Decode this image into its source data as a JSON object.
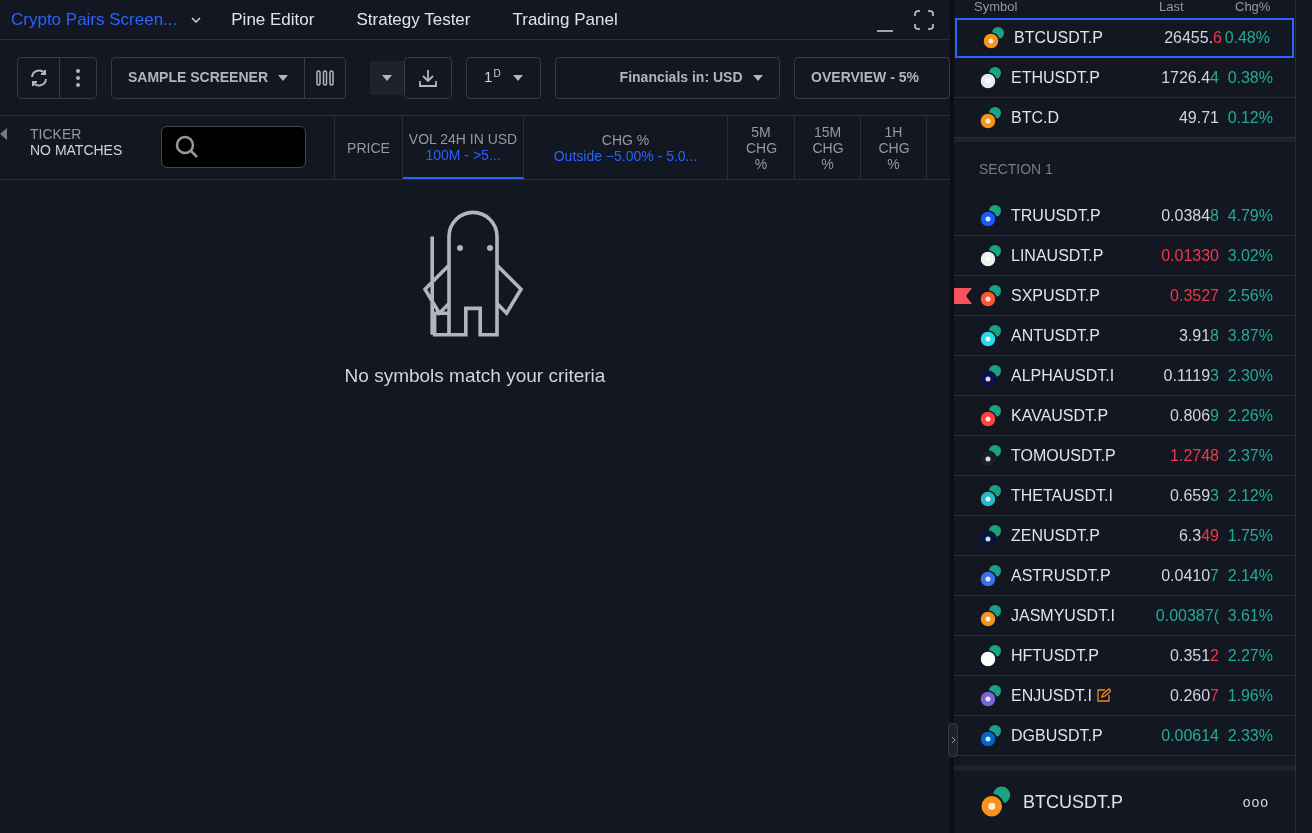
{
  "tabs": [
    {
      "label": "Crypto Pairs Screen...",
      "selected": true
    },
    {
      "label": "Pine Editor",
      "selected": false
    },
    {
      "label": "Strategy Tester",
      "selected": false
    },
    {
      "label": "Trading Panel",
      "selected": false
    }
  ],
  "toolbar": {
    "screener": "SAMPLE SCREENER",
    "interval": "1",
    "interval_sup": "D",
    "financials": "Financials in: USD",
    "view": "OVERVIEW - 5%"
  },
  "columns": [
    {
      "label": "PRICE",
      "selected": false
    },
    {
      "label": "VOL 24H IN USD",
      "filter": "100M - >5...",
      "selected": true
    },
    {
      "label": "CHG %",
      "filter": "Outside −5.00% - 5.0...",
      "selected": false
    },
    {
      "label": "5M CHG %",
      "selected": false
    },
    {
      "label": "15M CHG %",
      "selected": false
    },
    {
      "label": "1H CHG %",
      "selected": false
    }
  ],
  "ticker_column": {
    "label": "TICKER",
    "sublabel": "NO MATCHES"
  },
  "empty_message": "No symbols match your criteria",
  "watchlist": {
    "headers": [
      "Symbol",
      "Last",
      "Chg%"
    ],
    "top_rows": [
      {
        "symbol": "BTCUSDT.P",
        "color": "#f7931a",
        "selected": true,
        "flagged": false,
        "edited": false,
        "last_parts": [
          {
            "text": "26455.",
            "kind": "plain"
          },
          {
            "text": "6",
            "kind": "down"
          }
        ],
        "change": "0.48%"
      },
      {
        "symbol": "ETHUSDT.P",
        "color": "#e8eaf6",
        "selected": false,
        "flagged": false,
        "edited": false,
        "last_parts": [
          {
            "text": "1726.4",
            "kind": "plain"
          },
          {
            "text": "4",
            "kind": "up"
          }
        ],
        "change": "0.38%"
      },
      {
        "symbol": "BTC.D",
        "color": "#f7931a",
        "selected": false,
        "flagged": false,
        "edited": false,
        "last_parts": [
          {
            "text": "49.71",
            "kind": "plain"
          }
        ],
        "change": "0.12%"
      }
    ],
    "section": "SECTION 1",
    "rows": [
      {
        "symbol": "TRUUSDT.P",
        "color": "#1a5aff",
        "selected": false,
        "flagged": false,
        "edited": false,
        "last_parts": [
          {
            "text": "0.0384",
            "kind": "plain"
          },
          {
            "text": "8",
            "kind": "up"
          }
        ],
        "change": "4.79%"
      },
      {
        "symbol": "LINAUSDT.P",
        "color": "#f0f0f0",
        "selected": false,
        "flagged": false,
        "edited": false,
        "last_parts": [
          {
            "text": "0.01330",
            "kind": "down"
          }
        ],
        "change": "3.02%"
      },
      {
        "symbol": "SXPUSDT.P",
        "color": "#fd5631",
        "selected": false,
        "flagged": true,
        "edited": false,
        "last_parts": [
          {
            "text": "0.3527",
            "kind": "down"
          }
        ],
        "change": "2.56%"
      },
      {
        "symbol": "ANTUSDT.P",
        "color": "#2cd5f0",
        "selected": false,
        "flagged": false,
        "edited": false,
        "last_parts": [
          {
            "text": "3.91",
            "kind": "plain"
          },
          {
            "text": "8",
            "kind": "up"
          }
        ],
        "change": "3.87%"
      },
      {
        "symbol": "ALPHAUSDT.I",
        "color": "#0b1152",
        "selected": false,
        "flagged": false,
        "edited": false,
        "last_parts": [
          {
            "text": "0.1119",
            "kind": "plain"
          },
          {
            "text": "3",
            "kind": "up"
          }
        ],
        "change": "2.30%"
      },
      {
        "symbol": "KAVAUSDT.P",
        "color": "#ff433e",
        "selected": false,
        "flagged": false,
        "edited": false,
        "last_parts": [
          {
            "text": "0.806",
            "kind": "plain"
          },
          {
            "text": "9",
            "kind": "up"
          }
        ],
        "change": "2.26%"
      },
      {
        "symbol": "TOMOUSDT.P",
        "color": "#1a1f2b",
        "selected": false,
        "flagged": false,
        "edited": false,
        "last_parts": [
          {
            "text": "1.2748",
            "kind": "down"
          }
        ],
        "change": "2.37%"
      },
      {
        "symbol": "THETAUSDT.I",
        "color": "#2ab8c6",
        "selected": false,
        "flagged": false,
        "edited": false,
        "last_parts": [
          {
            "text": "0.659",
            "kind": "plain"
          },
          {
            "text": "3",
            "kind": "up"
          }
        ],
        "change": "2.12%"
      },
      {
        "symbol": "ZENUSDT.P",
        "color": "#041742",
        "selected": false,
        "flagged": false,
        "edited": false,
        "last_parts": [
          {
            "text": "6.3",
            "kind": "plain"
          },
          {
            "text": "49",
            "kind": "down"
          }
        ],
        "change": "1.75%"
      },
      {
        "symbol": "ASTRUSDT.P",
        "color": "#3a6ff0",
        "selected": false,
        "flagged": false,
        "edited": false,
        "last_parts": [
          {
            "text": "0.0410",
            "kind": "plain"
          },
          {
            "text": "7",
            "kind": "up"
          }
        ],
        "change": "2.14%"
      },
      {
        "symbol": "JASMYUSDT.I",
        "color": "#f39320",
        "selected": false,
        "flagged": false,
        "edited": false,
        "last_parts": [
          {
            "text": "0.00387(",
            "kind": "up"
          }
        ],
        "change": "3.61%"
      },
      {
        "symbol": "HFTUSDT.P",
        "color": "#ffffff",
        "selected": false,
        "flagged": false,
        "edited": false,
        "last_parts": [
          {
            "text": "0.351",
            "kind": "plain"
          },
          {
            "text": "2",
            "kind": "down"
          }
        ],
        "change": "2.27%"
      },
      {
        "symbol": "ENJUSDT.I",
        "color": "#7866d5",
        "selected": false,
        "flagged": false,
        "edited": true,
        "last_parts": [
          {
            "text": "0.260",
            "kind": "plain"
          },
          {
            "text": "7",
            "kind": "down"
          }
        ],
        "change": "1.96%"
      },
      {
        "symbol": "DGBUSDT.P",
        "color": "#0066cc",
        "selected": false,
        "flagged": false,
        "edited": false,
        "last_parts": [
          {
            "text": "0.00614",
            "kind": "up"
          }
        ],
        "change": "2.33%"
      }
    ],
    "footer": {
      "symbol": "BTCUSDT.P",
      "color": "#f7931a",
      "more": "ooo"
    }
  }
}
